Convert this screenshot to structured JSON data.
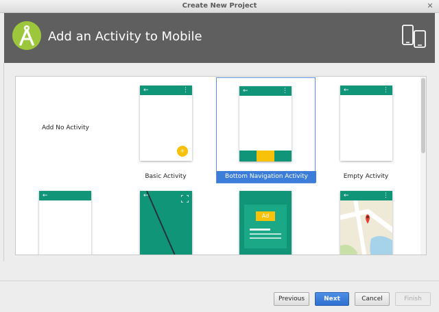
{
  "window": {
    "title": "Create New Project"
  },
  "header": {
    "title": "Add an Activity to Mobile"
  },
  "templates": [
    {
      "label": "Add No Activity"
    },
    {
      "label": "Basic Activity"
    },
    {
      "label": "Bottom Navigation Activity"
    },
    {
      "label": "Empty Activity"
    },
    {
      "label": ""
    },
    {
      "label": ""
    },
    {
      "label": ""
    },
    {
      "label": ""
    }
  ],
  "ad_badge": "Ad",
  "footer": {
    "previous": "Previous",
    "next": "Next",
    "cancel": "Cancel",
    "finish": "Finish"
  },
  "colors": {
    "header_bg": "#5f5f5f",
    "material_teal": "#109579",
    "fab_yellow": "#f9c20a",
    "selection_blue": "#3b7dd8"
  },
  "icons": {
    "logo": "android-studio-logo",
    "device": "phone-tablet-icon",
    "back": "arrow-left-icon",
    "menu": "more-vert-icon",
    "fullscreen": "fullscreen-icon",
    "map_pin": "map-pin-icon"
  }
}
